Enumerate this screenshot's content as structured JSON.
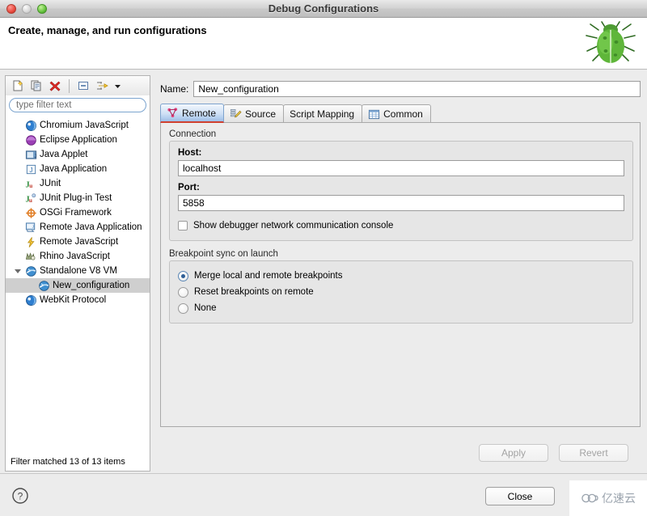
{
  "window": {
    "title": "Debug Configurations",
    "traffic_lights": [
      "close-button",
      "minimize-button",
      "zoom-button"
    ]
  },
  "header": {
    "title": "Create, manage, and run configurations",
    "mascot_icon": "green-bug-icon"
  },
  "left_panel": {
    "toolbar": [
      {
        "name": "new-launch-configuration-button",
        "icon": "new-document-icon"
      },
      {
        "name": "duplicate-launch-configuration-button",
        "icon": "copy-document-icon"
      },
      {
        "name": "delete-launch-configuration-button",
        "icon": "red-x-delete-icon"
      },
      {
        "name": "collapse-all-button",
        "icon": "collapse-all-icon"
      },
      {
        "name": "filter-launch-configurations-button",
        "icon": "yellow-filter-arrow-icon"
      },
      {
        "name": "filter-dropdown-arrow",
        "icon": "chevron-down-icon"
      }
    ],
    "filter": {
      "placeholder": "type filter text",
      "value": ""
    },
    "tree": [
      {
        "label": "Chromium JavaScript",
        "icon": "blue-globe-icon",
        "indent": 0,
        "twisty": "none",
        "selected": false
      },
      {
        "label": "Eclipse Application",
        "icon": "purple-circle-icon",
        "indent": 0,
        "twisty": "none",
        "selected": false
      },
      {
        "label": "Java Applet",
        "icon": "java-applet-icon",
        "indent": 0,
        "twisty": "none",
        "selected": false
      },
      {
        "label": "Java Application",
        "icon": "java-application-icon",
        "indent": 0,
        "twisty": "none",
        "selected": false
      },
      {
        "label": "JUnit",
        "icon": "junit-icon",
        "indent": 0,
        "twisty": "none",
        "selected": false
      },
      {
        "label": "JUnit Plug-in Test",
        "icon": "junit-plugin-icon",
        "indent": 0,
        "twisty": "none",
        "selected": false
      },
      {
        "label": "OSGi Framework",
        "icon": "osgi-icon",
        "indent": 0,
        "twisty": "none",
        "selected": false
      },
      {
        "label": "Remote Java Application",
        "icon": "remote-java-icon",
        "indent": 0,
        "twisty": "none",
        "selected": false
      },
      {
        "label": "Remote JavaScript",
        "icon": "remote-javascript-icon",
        "indent": 0,
        "twisty": "none",
        "selected": false
      },
      {
        "label": "Rhino JavaScript",
        "icon": "rhino-icon",
        "indent": 0,
        "twisty": "none",
        "selected": false
      },
      {
        "label": "Standalone V8 VM",
        "icon": "v8-vm-icon",
        "indent": 0,
        "twisty": "open",
        "selected": false
      },
      {
        "label": "New_configuration",
        "icon": "v8-vm-icon",
        "indent": 1,
        "twisty": "none",
        "selected": true
      },
      {
        "label": "WebKit Protocol",
        "icon": "blue-globe-icon",
        "indent": 0,
        "twisty": "none",
        "selected": false
      }
    ],
    "status": "Filter matched 13 of 13 items"
  },
  "right_panel": {
    "name_label": "Name:",
    "name_value": "New_configuration",
    "tabs": [
      {
        "label": "Remote",
        "icon": "remote-node-icon",
        "active": true
      },
      {
        "label": "Source",
        "icon": "source-pencil-icon",
        "active": false
      },
      {
        "label": "Script Mapping",
        "icon": "none",
        "active": false
      },
      {
        "label": "Common",
        "icon": "common-table-icon",
        "active": false
      }
    ],
    "connection": {
      "group_label": "Connection",
      "host_label": "Host:",
      "host_value": "localhost",
      "port_label": "Port:",
      "port_value": "5858",
      "console_checkbox_label": "Show debugger network communication console",
      "console_checked": false
    },
    "breakpoint_sync": {
      "group_label": "Breakpoint sync on launch",
      "options": [
        {
          "label": "Merge local and remote breakpoints",
          "checked": true
        },
        {
          "label": "Reset breakpoints on remote",
          "checked": false
        },
        {
          "label": "None",
          "checked": false
        }
      ]
    }
  },
  "footer": {
    "apply_label": "Apply",
    "apply_enabled": false,
    "revert_label": "Revert",
    "revert_enabled": false,
    "close_label": "Close",
    "help_icon": "question-mark-icon",
    "watermark_text": "亿速云",
    "watermark_icon": "cloud-logo-icon"
  },
  "colors": {
    "accent_blue": "#2f5f96",
    "tab_underline": "#d0402f",
    "selection_gray": "#cfcfcf",
    "panel_gray": "#ececec"
  }
}
